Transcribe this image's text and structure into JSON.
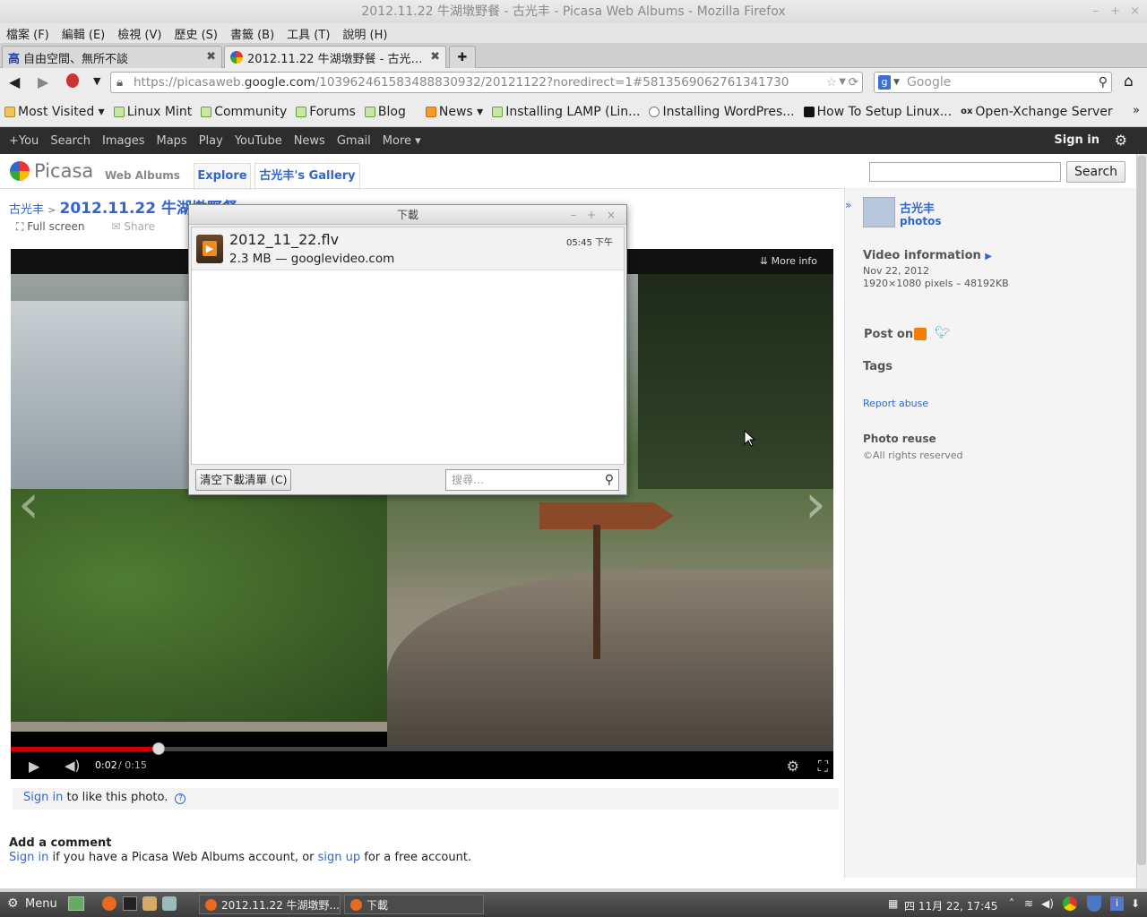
{
  "window": {
    "title": "2012.11.22 牛湖墩野餐 - 古光丰 - Picasa Web Albums - Mozilla Firefox"
  },
  "menubar": [
    "檔案 (F)",
    "編輯 (E)",
    "檢視 (V)",
    "歷史 (S)",
    "書籤 (B)",
    "工具 (T)",
    "說明 (H)"
  ],
  "tabs": [
    {
      "label": "自由空間、無所不談"
    },
    {
      "label": "2012.11.22 牛湖墩野餐 - 古光…"
    }
  ],
  "nav": {
    "url_prefix": "https://picasaweb.",
    "url_domain": "google.com",
    "url_rest": "/103962461583488830932/20121122?noredirect=1#5813569062761341730",
    "search_placeholder": "Google"
  },
  "bookmarks": [
    "Most Visited ▾",
    "Linux Mint",
    "Community",
    "Forums",
    "Blog",
    "News ▾",
    "Installing LAMP (Lin...",
    "Installing WordPres...",
    "How To Setup Linux...",
    "Open-Xchange Server"
  ],
  "gbar": {
    "items": [
      "+You",
      "Search",
      "Images",
      "Maps",
      "Play",
      "YouTube",
      "News",
      "Gmail",
      "More ▾"
    ],
    "signin": "Sign in"
  },
  "picasa": {
    "logo": "Picasa",
    "logo_sub": "Web Albums",
    "tabs": [
      "Explore",
      "古光丰's Gallery"
    ],
    "search_button": "Search"
  },
  "breadcrumb": {
    "user": "古光丰",
    "sep": ">",
    "album": "2012.11.22 牛湖墩野餐"
  },
  "toolbar": {
    "fullscreen": "Full screen",
    "share": "Share"
  },
  "video": {
    "more_info": "More info",
    "time_current": "0:02",
    "time_total": "/ 0:15",
    "progress": 0.18
  },
  "like": {
    "signin": "Sign in",
    "text": "to like this photo."
  },
  "comment": {
    "heading": "Add a comment",
    "signin": "Sign in",
    "middle": "if you have a Picasa Web Albums account, or",
    "signup": "sign up",
    "end": "for a free account."
  },
  "sidebar": {
    "user": "古光丰",
    "photos": "photos",
    "video_info": "Video information",
    "date": "Nov 22, 2012",
    "dims": "1920×1080 pixels – 48192KB",
    "post_on": "Post on:",
    "tags": "Tags",
    "report": "Report abuse",
    "reuse": "Photo reuse",
    "rights": "All rights reserved"
  },
  "download_dialog": {
    "title": "下載",
    "file": "2012_11_22.flv",
    "info": "2.3 MB — googlevideo.com",
    "time": "05:45 下午",
    "clear_button": "清空下載清單 (C)",
    "search_placeholder": "搜尋…"
  },
  "taskbar": {
    "menu": "Menu",
    "task1": "2012.11.22 牛湖墩野...",
    "task2": "下載",
    "clock": "四 11月 22, 17:45"
  }
}
